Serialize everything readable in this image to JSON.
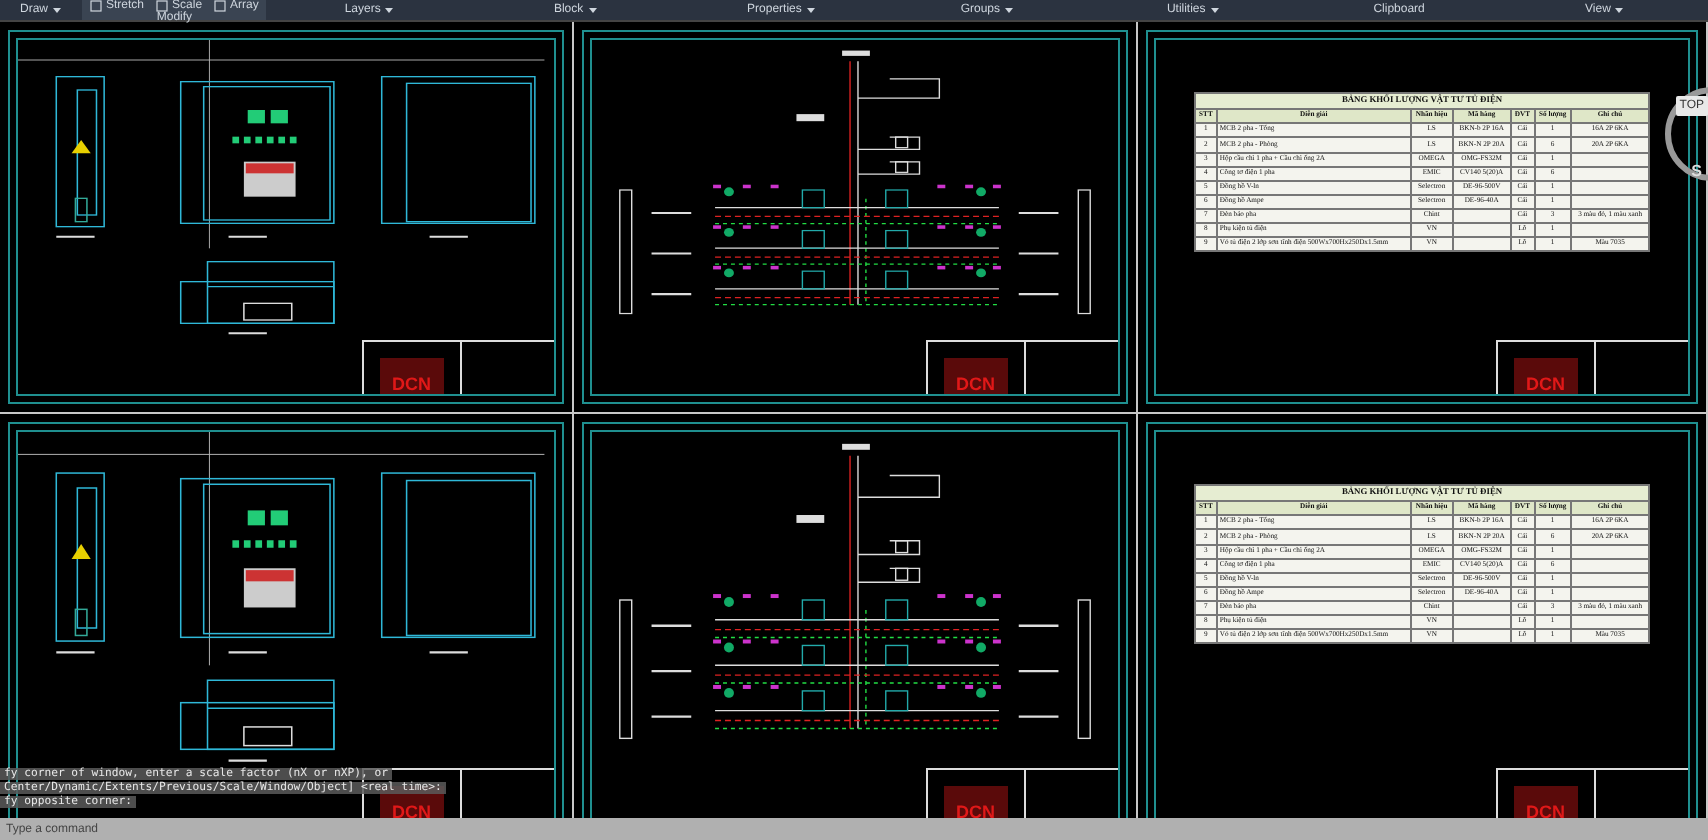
{
  "ribbon": {
    "panels": [
      {
        "label": "Draw",
        "has_menu": true
      },
      {
        "label": "Modify",
        "tools": [
          "Stretch",
          "Scale",
          "Array"
        ]
      },
      {
        "label": "Layers",
        "has_menu": true
      },
      {
        "label": "Block",
        "has_menu": true
      },
      {
        "label": "Properties",
        "has_menu": true
      },
      {
        "label": "Groups",
        "has_menu": true
      },
      {
        "label": "Utilities",
        "has_menu": true
      },
      {
        "label": "Clipboard",
        "has_menu": false
      },
      {
        "label": "View",
        "has_menu": true
      }
    ]
  },
  "sheets": [
    {
      "kind": "enclosure",
      "title_block": {
        "logo": "DCN"
      }
    },
    {
      "kind": "schematic",
      "title_block": {
        "logo": "DCN"
      }
    },
    {
      "kind": "table",
      "title_block": {
        "logo": "DCN"
      },
      "table": {
        "title": "BẢNG KHỐI LƯỢNG VẬT TƯ TỦ ĐIỆN",
        "columns": [
          "STT",
          "Diễn giải",
          "Nhãn hiệu",
          "Mã hàng",
          "ĐVT",
          "Số lượng",
          "Ghi chú"
        ],
        "rows": [
          [
            "1",
            "MCB 2 pha - Tổng",
            "LS",
            "BKN-b 2P 16A",
            "Cái",
            "1",
            "16A 2P 6KA"
          ],
          [
            "2",
            "MCB 2 pha - Phòng",
            "LS",
            "BKN-N 2P 20A",
            "Cái",
            "6",
            "20A 2P 6KA"
          ],
          [
            "3",
            "Hộp cầu chì 1 pha + Cầu chì ống 2A",
            "OMEGA",
            "OMG-FS32M",
            "Cái",
            "1",
            ""
          ],
          [
            "4",
            "Công tơ điện 1 pha",
            "EMIC",
            "CV140 5(20)A",
            "Cái",
            "6",
            ""
          ],
          [
            "5",
            "Đồng hồ V-ln",
            "Selectron",
            "DE-96-500V",
            "Cái",
            "1",
            ""
          ],
          [
            "6",
            "Đồng hồ Ampe",
            "Selectron",
            "DE-96-40A",
            "Cái",
            "1",
            ""
          ],
          [
            "7",
            "Đèn báo pha",
            "Chint",
            "",
            "Cái",
            "3",
            "3 màu đỏ, 1 màu xanh"
          ],
          [
            "8",
            "Phụ kiện tủ điện",
            "VN",
            "",
            "Lô",
            "1",
            ""
          ],
          [
            "9",
            "Vỏ tủ điện 2 lớp sơn tĩnh điện 500Wx700Hx250Dx1.5mm",
            "VN",
            "",
            "Lô",
            "1",
            "Màu 7035"
          ]
        ]
      }
    },
    {
      "kind": "enclosure",
      "title_block": {
        "logo": "DCN"
      }
    },
    {
      "kind": "schematic",
      "title_block": {
        "logo": "DCN"
      }
    },
    {
      "kind": "table",
      "title_block": {
        "logo": "DCN"
      },
      "table": {
        "title": "BẢNG KHỐI LƯỢNG VẬT TƯ TỦ ĐIỆN",
        "columns": [
          "STT",
          "Diễn giải",
          "Nhãn hiệu",
          "Mã hàng",
          "ĐVT",
          "Số lượng",
          "Ghi chú"
        ],
        "rows": [
          [
            "1",
            "MCB 2 pha - Tổng",
            "LS",
            "BKN-b 2P 16A",
            "Cái",
            "1",
            "16A 2P 6KA"
          ],
          [
            "2",
            "MCB 2 pha - Phòng",
            "LS",
            "BKN-N 2P 20A",
            "Cái",
            "6",
            "20A 2P 6KA"
          ],
          [
            "3",
            "Hộp cầu chì 1 pha + Cầu chì ống 2A",
            "OMEGA",
            "OMG-FS32M",
            "Cái",
            "1",
            ""
          ],
          [
            "4",
            "Công tơ điện 1 pha",
            "EMIC",
            "CV140 5(20)A",
            "Cái",
            "6",
            ""
          ],
          [
            "5",
            "Đồng hồ V-ln",
            "Selectron",
            "DE-96-500V",
            "Cái",
            "1",
            ""
          ],
          [
            "6",
            "Đồng hồ Ampe",
            "Selectron",
            "DE-96-40A",
            "Cái",
            "1",
            ""
          ],
          [
            "7",
            "Đèn báo pha",
            "Chint",
            "",
            "Cái",
            "3",
            "3 màu đỏ, 1 màu xanh"
          ],
          [
            "8",
            "Phụ kiện tủ điện",
            "VN",
            "",
            "Lô",
            "1",
            ""
          ],
          [
            "9",
            "Vỏ tủ điện 2 lớp sơn tĩnh điện 500Wx700Hx250Dx1.5mm",
            "VN",
            "",
            "Lô",
            "1",
            "Màu 7035"
          ]
        ]
      }
    }
  ],
  "viewcube": {
    "face": "TOP",
    "compass_south": "S"
  },
  "command_line": {
    "history": [
      "fy corner of window, enter a scale factor (nX or nXP), or",
      "Center/Dynamic/Extents/Previous/Scale/Window/Object] <real time>:",
      "fy opposite corner:"
    ],
    "prompt": "Type a command"
  }
}
